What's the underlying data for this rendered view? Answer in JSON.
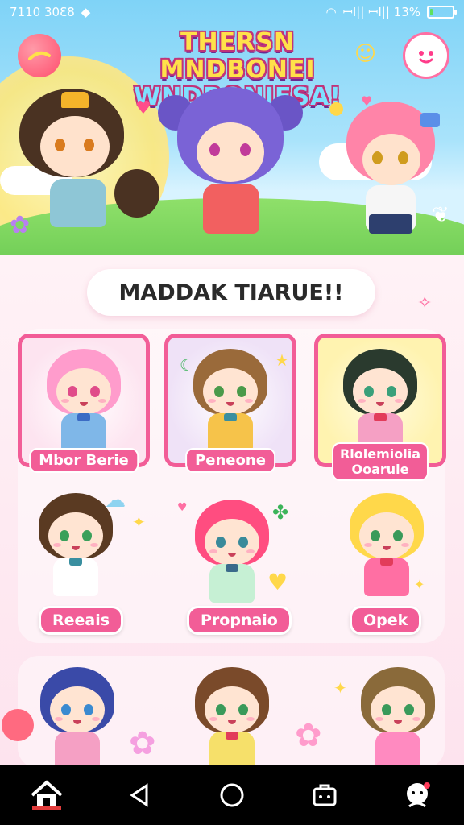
{
  "status_bar": {
    "time": "7110 30Ɛ8",
    "signal_text": "ꟷI|| ꟷI|| 13%",
    "battery_percent": 13
  },
  "banner": {
    "title_line1": "THERSN MNDBONEI",
    "title_line2": "WNDRONIESA!"
  },
  "section": {
    "title": "MADDAK TIARUE!!"
  },
  "characters": {
    "featured": [
      {
        "label": "Mbor Berie"
      },
      {
        "label": "Peneone"
      },
      {
        "label_line1": "Rlolemiolia",
        "label_line2": "Ooarule"
      }
    ],
    "row2": [
      {
        "label": "Reeais"
      },
      {
        "label": "Propnaio"
      },
      {
        "label": "Opek"
      }
    ]
  },
  "navbar": {
    "items": [
      "home",
      "back",
      "home-circle",
      "inventory",
      "profile"
    ]
  },
  "colors": {
    "accent": "#f25d97",
    "background": "#fde6ef",
    "sky": "#7fd3f7"
  }
}
